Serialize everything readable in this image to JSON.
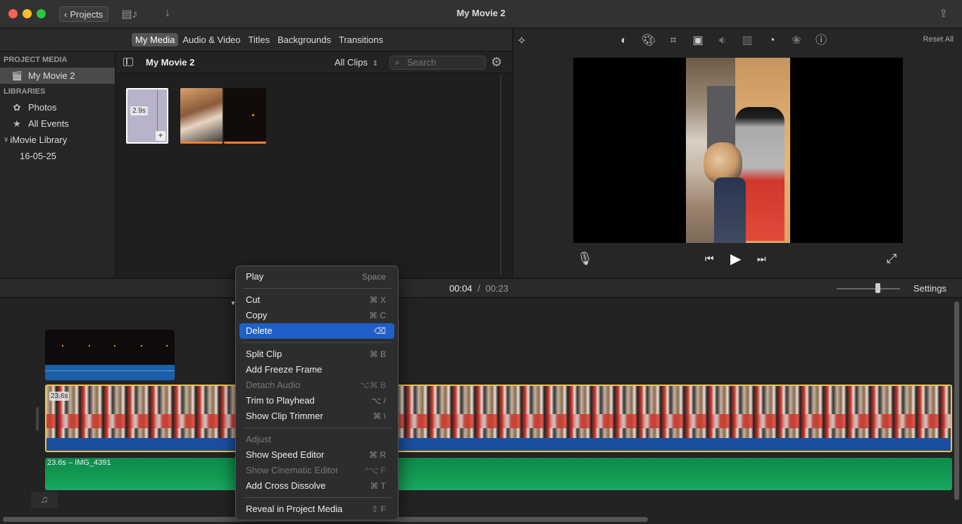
{
  "titlebar": {
    "back_label": "Projects",
    "window_title": "My Movie 2"
  },
  "browser_tabs": [
    "My Media",
    "Audio & Video",
    "Titles",
    "Backgrounds",
    "Transitions"
  ],
  "sidebar": {
    "project_media_heading": "PROJECT MEDIA",
    "project_item": "My Movie 2",
    "libraries_heading": "LIBRARIES",
    "items": [
      {
        "label": "Photos",
        "icon": "photos-icon"
      },
      {
        "label": "All Events",
        "icon": "star-icon"
      }
    ],
    "library": "iMovie Library",
    "event": "16-05-25"
  },
  "media": {
    "title": "My Movie 2",
    "filter": "All Clips",
    "search_placeholder": "Search",
    "clip1_duration": "2.9s"
  },
  "viewer": {
    "reset_label": "Reset All"
  },
  "timeline": {
    "current_time": "00:04",
    "separator": "/",
    "total_time": "00:23",
    "settings_label": "Settings",
    "clip_duration": "23.6s",
    "audio_label": "23.6s – IMG_4391"
  },
  "context_menu": {
    "items": [
      {
        "label": "Play",
        "shortcut": "Space"
      },
      {
        "label": "Cut",
        "shortcut": "⌘ X"
      },
      {
        "label": "Copy",
        "shortcut": "⌘ C"
      },
      {
        "label": "Delete",
        "shortcut": "⌫"
      },
      {
        "label": "Split Clip",
        "shortcut": "⌘ B"
      },
      {
        "label": "Add Freeze Frame",
        "shortcut": ""
      },
      {
        "label": "Detach Audio",
        "shortcut": "⌥⌘ B"
      },
      {
        "label": "Trim to Playhead",
        "shortcut": "⌥ /"
      },
      {
        "label": "Show Clip Trimmer",
        "shortcut": "⌘ \\"
      },
      {
        "label": "Adjust",
        "shortcut": ""
      },
      {
        "label": "Show Speed Editor",
        "shortcut": "⌘ R"
      },
      {
        "label": "Show Cinematic Editor",
        "shortcut": "^⌥ F"
      },
      {
        "label": "Add Cross Dissolve",
        "shortcut": "⌘ T"
      },
      {
        "label": "Reveal in Project Media",
        "shortcut": "⇧ F"
      }
    ]
  },
  "colors": {
    "highlight": "#1f5fc8",
    "clip_border": "#f5c242",
    "audio_green": "#149a55"
  }
}
